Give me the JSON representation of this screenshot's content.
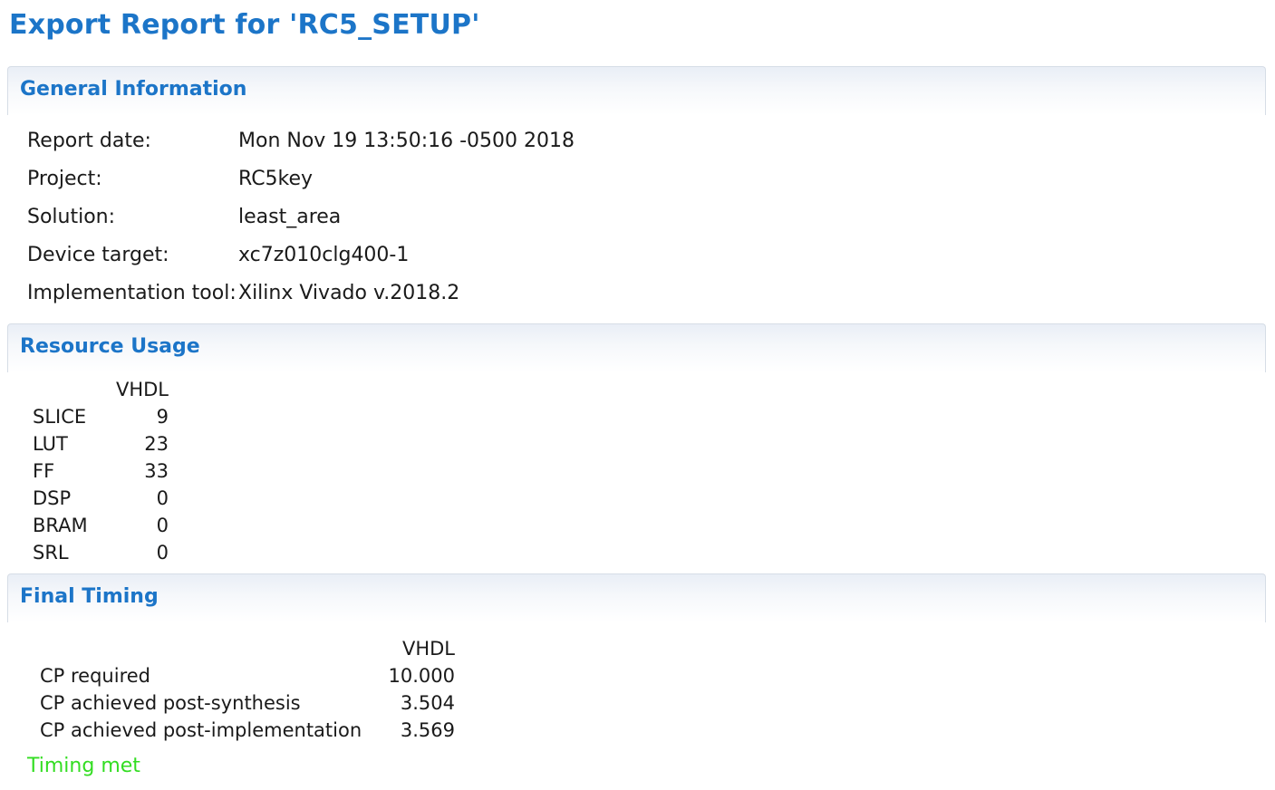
{
  "title": "Export Report for 'RC5_SETUP'",
  "colors": {
    "accent": "#1c75c8",
    "status_ok": "#33dd22"
  },
  "general": {
    "header": "General Information",
    "rows": [
      {
        "label": "Report date:",
        "value": "Mon Nov 19 13:50:16 -0500 2018"
      },
      {
        "label": "Project:",
        "value": "RC5key"
      },
      {
        "label": "Solution:",
        "value": "least_area"
      },
      {
        "label": "Device target:",
        "value": "xc7z010clg400-1"
      },
      {
        "label": "Implementation tool:",
        "value": "Xilinx Vivado v.2018.2"
      }
    ]
  },
  "resources": {
    "header": "Resource Usage",
    "column": "VHDL",
    "rows": [
      {
        "name": "SLICE",
        "value": "9"
      },
      {
        "name": "LUT",
        "value": "23"
      },
      {
        "name": "FF",
        "value": "33"
      },
      {
        "name": "DSP",
        "value": "0"
      },
      {
        "name": "BRAM",
        "value": "0"
      },
      {
        "name": "SRL",
        "value": "0"
      }
    ]
  },
  "timing": {
    "header": "Final Timing",
    "column": "VHDL",
    "rows": [
      {
        "name": "CP required",
        "value": "10.000"
      },
      {
        "name": "CP achieved post-synthesis",
        "value": "3.504"
      },
      {
        "name": "CP achieved post-implementation",
        "value": "3.569"
      }
    ],
    "status": "Timing met"
  }
}
